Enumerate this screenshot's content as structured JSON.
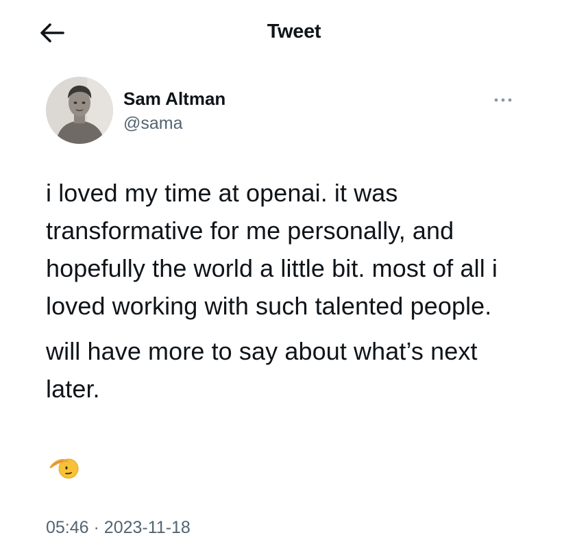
{
  "header": {
    "back_icon": "arrow-left-icon",
    "title": "Tweet"
  },
  "author": {
    "name": "Sam Altman",
    "handle": "@sama",
    "more_icon": "more-horizontal-icon"
  },
  "tweet": {
    "paragraphs": [
      "i loved my time at openai. it was transformative for me personally, and hopefully the world a little bit. most of all i loved working with such talented people.",
      "will have more to say about what’s next later."
    ],
    "emoji": "saluting-face-icon"
  },
  "meta": {
    "time": "05:46",
    "separator": "·",
    "date": "2023-11-18"
  },
  "colors": {
    "text_primary": "#0f1419",
    "text_secondary": "#536471",
    "background": "#ffffff"
  }
}
